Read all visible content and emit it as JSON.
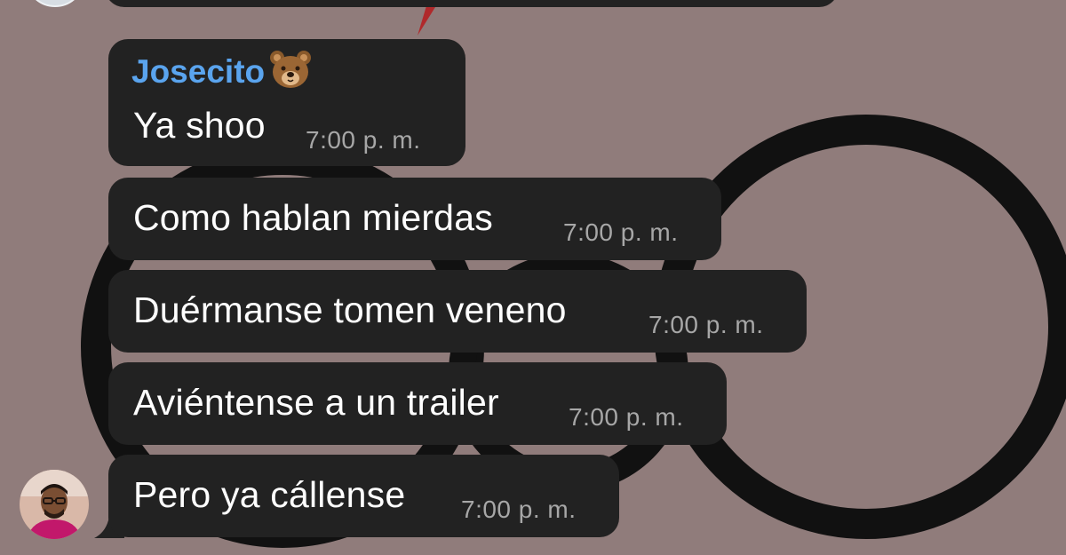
{
  "colors": {
    "wallpaper": "#907c7b",
    "bubble": "#222222",
    "sender_name": "#5aa4ee",
    "message_text": "#ffffff",
    "timestamp": "#a7a7a7"
  },
  "chat": {
    "sender": {
      "name": "Josecito",
      "emoji_icon": "bear-face-icon"
    },
    "messages": [
      {
        "text": "Ya shoo",
        "time": "7:00 p. m."
      },
      {
        "text": "Como hablan mierdas",
        "time": "7:00 p. m."
      },
      {
        "text": "Duérmanse tomen veneno",
        "time": "7:00 p. m."
      },
      {
        "text": "Aviéntense a un trailer",
        "time": "7:00 p. m."
      },
      {
        "text": "Pero ya cállense",
        "time": "7:00 p. m."
      }
    ]
  }
}
